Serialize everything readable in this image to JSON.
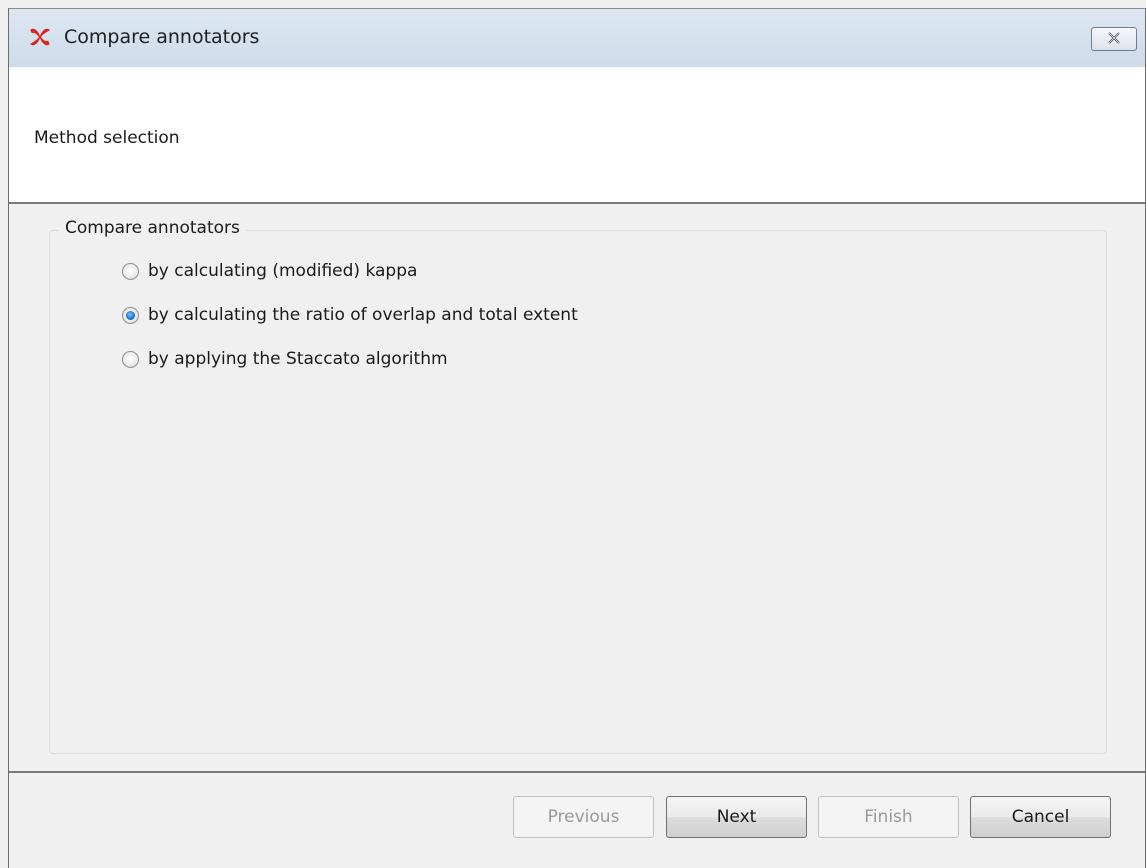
{
  "window": {
    "title": "Compare annotators",
    "icon": "app-logo-icon",
    "close_icon": "close-icon"
  },
  "header": {
    "step_label": "Method selection"
  },
  "group": {
    "legend": "Compare annotators",
    "options": [
      {
        "label": "by calculating (modified) kappa",
        "selected": false
      },
      {
        "label": "by calculating the ratio of overlap and total extent",
        "selected": true
      },
      {
        "label": "by applying the Staccato algorithm",
        "selected": false
      }
    ]
  },
  "buttons": {
    "previous": {
      "label": "Previous",
      "enabled": false
    },
    "next": {
      "label": "Next",
      "enabled": true
    },
    "finish": {
      "label": "Finish",
      "enabled": false
    },
    "cancel": {
      "label": "Cancel",
      "enabled": true
    }
  },
  "colors": {
    "accent": "#1d7ad4",
    "icon_red": "#d8261d"
  }
}
